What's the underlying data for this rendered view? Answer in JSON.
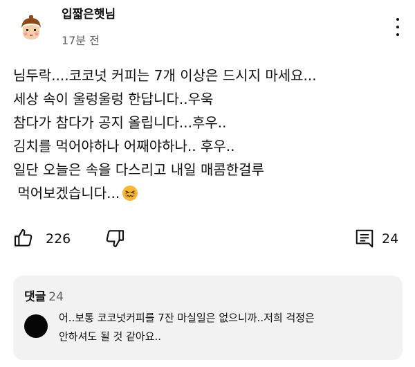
{
  "comment": {
    "author": "입짧은햇님",
    "time": "17분 전",
    "lines": [
      "님두락....코코넛 커피는 7개 이상은 드시지 마세요...",
      "세상 속이 울렁울렁 한답니다..우욱",
      "참다가 참다가 공지 올립니다...후우..",
      "김치를 먹어야하나 어째야하나.. 후우..",
      "일단 오늘은 속을 다스리고 내일 매콤한걸루",
      " 먹어보겠습니다..."
    ],
    "emoji": "confounded-face-emoji",
    "like_count": "226",
    "reply_count": "24"
  },
  "replies": {
    "label": "댓글",
    "count": "24",
    "preview_lines": [
      "어..보통 코코넛커피를 7잔 마실일은 없으니까..저희 걱정은",
      "안하셔도 될 것 같아요.."
    ]
  },
  "icons": {
    "like": "thumbs-up-icon",
    "dislike": "thumbs-down-icon",
    "reply": "comment-icon",
    "more": "more-vert-icon"
  },
  "colors": {
    "text": "#0f0f0f",
    "secondary": "#606060",
    "reply_bg": "#f2f2f2"
  }
}
